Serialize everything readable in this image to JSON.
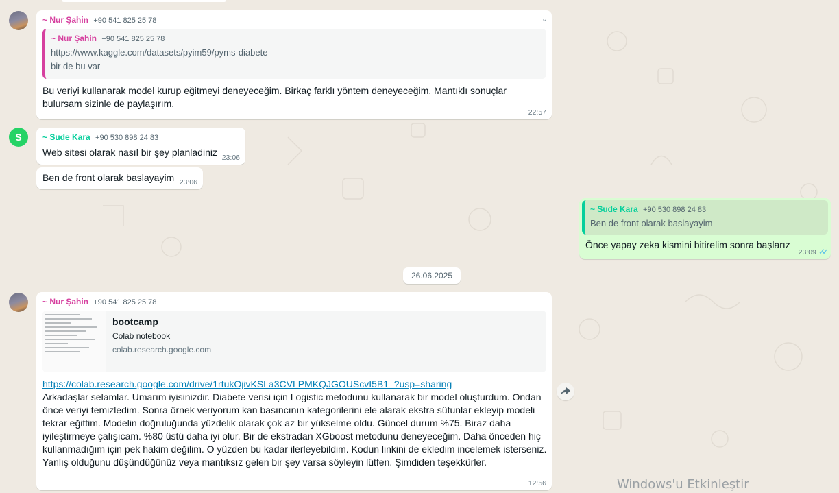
{
  "contacts": {
    "nur": {
      "name": "~ Nur Şahin",
      "phone": "+90 541 825 25 78"
    },
    "sude": {
      "name": "~ Sude Kara",
      "phone": "+90 530 898 24 83",
      "initial": "S"
    }
  },
  "messages": {
    "m1": {
      "quote_url": "https://www.kaggle.com/datasets/pyim59/pyms-diabete",
      "quote_text": "bir de bu var",
      "text": "Bu veriyi kullanarak model kurup eğitmeyi deneyeceğim. Birkaç farklı yöntem deneyeceğim. Mantıklı sonuçlar bulursam sizinle de paylaşırım.",
      "time": "22:57"
    },
    "m2": {
      "text": "Web sitesi olarak nasıl bir şey planladiniz",
      "time": "23:06"
    },
    "m3": {
      "text": "Ben de front olarak baslayayim",
      "time": "23:06"
    },
    "m4": {
      "quote_text": "Ben de front olarak baslayayim",
      "text": "Önce yapay zeka kismini bitirelim sonra başlarız",
      "time": "23:09",
      "status": "read"
    },
    "date_separator": "26.06.2025",
    "m5": {
      "preview_title": "bootcamp",
      "preview_desc": "Colab notebook",
      "preview_site": "colab.research.google.com",
      "url": "https://colab.research.google.com/drive/1rtukOjivKSLa3CVLPMKQJGOUScvI5B1_?usp=sharing",
      "text": "Arkadaşlar selamlar. Umarım iyisinizdir. Diabete verisi için Logistic metodunu kullanarak bir model oluşturdum. Ondan önce veriyi temizledim. Sonra örnek veriyorum kan basıncının kategorilerini ele alarak ekstra sütunlar ekleyip modeli tekrar eğittim. Modelin doğruluğunda yüzdelik olarak çok az bir yükselme oldu. Güncel durum %75. Biraz daha iyileştirmeye çalışıcam. %80 üstü daha iyi olur. Bir de ekstradan XGboost metodunu deneyeceğim. Daha önceden hiç kullanmadığım için pek hakim değilim. O yüzden bu kadar ilerleyebildim. Kodun linkini de ekledim incelemek isterseniz. Yanlış olduğunu düşündüğünüz veya mantıksız gelen bir şey varsa söyleyin lütfen. Şimdiden teşekkürler.",
      "time": "12:56"
    }
  },
  "watermark": "Windows'u Etkinleştir",
  "colors": {
    "nur": "#d6409f",
    "sude": "#06cf9c",
    "outgoing": "#d9fdd3",
    "background": "#efeae2",
    "read_ticks": "#53bdeb"
  }
}
